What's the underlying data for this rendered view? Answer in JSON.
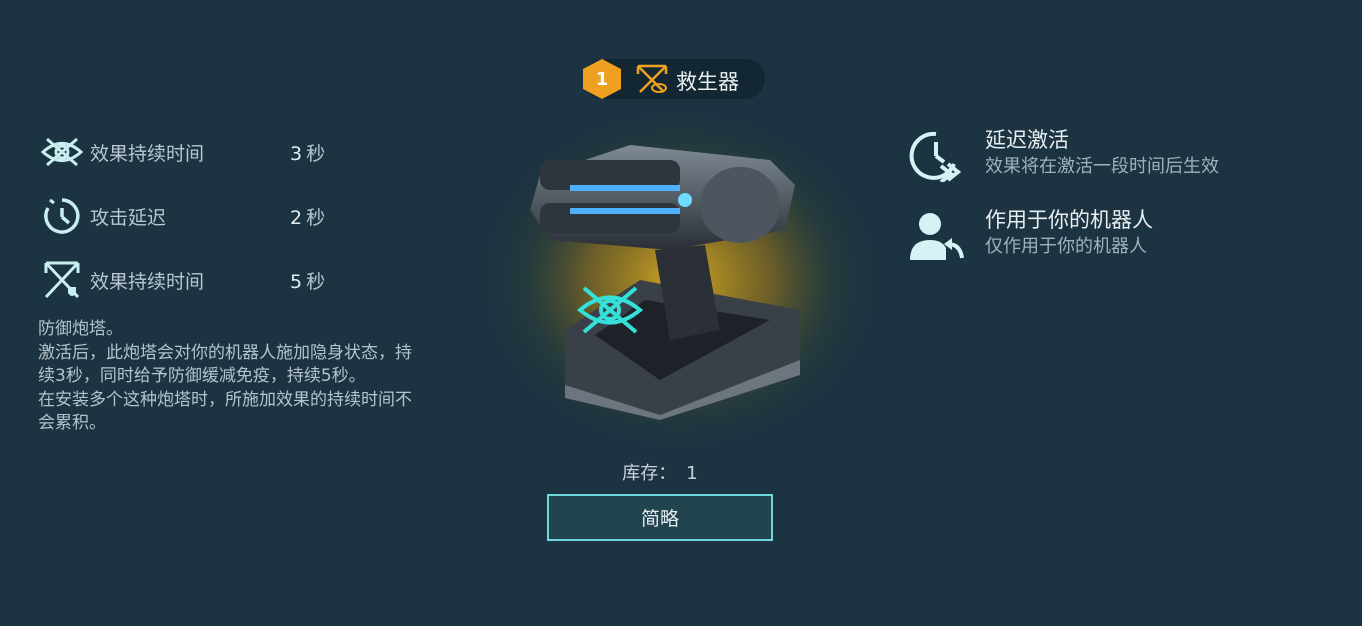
{
  "header": {
    "level": "1",
    "title": "救生器",
    "icon": "shield-disabled-icon"
  },
  "stats": [
    {
      "icon": "invisible-eye-icon",
      "label": "效果持续时间",
      "value": "3",
      "unit": "秒"
    },
    {
      "icon": "clock-delay-icon",
      "label": "攻击延迟",
      "value": "2",
      "unit": "秒"
    },
    {
      "icon": "shield-disabled-icon",
      "label": "效果持续时间",
      "value": "5",
      "unit": "秒"
    }
  ],
  "description": "防御炮塔。\n激活后，此炮塔会对你的机器人施加隐身状态，持续3秒，同时给予防御缓减免疫，持续5秒。\n在安装多个这种炮塔时，所施加效果的持续时间不会累积。",
  "stock": {
    "label": "库存：",
    "value": "1"
  },
  "brief_button": "简略",
  "features": [
    {
      "icon": "delayed-activation-icon",
      "title": "延迟激活",
      "subtitle": "效果将在激活一段时间后生效"
    },
    {
      "icon": "user-robot-icon",
      "title": "作用于你的机器人",
      "subtitle": "仅作用于你的机器人"
    }
  ],
  "colors": {
    "background": "#1c3441",
    "accent": "#6fd6dc",
    "badge": "#f0a020"
  }
}
